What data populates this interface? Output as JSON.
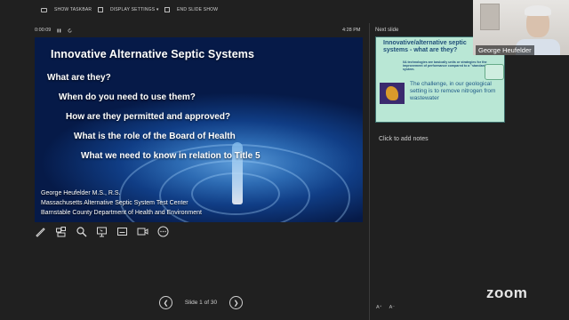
{
  "toolbar": {
    "show_taskbar": "SHOW TASKBAR",
    "display_settings": "DISPLAY SETTINGS ▾",
    "end_slide_show": "END SLIDE SHOW"
  },
  "presenter": {
    "elapsed": "0:00:09",
    "clock": "4:28 PM",
    "next_slide_label": "Next slide",
    "notes_placeholder": "Click to add notes",
    "slide_counter": "Slide 1 of 30",
    "prev_icon": "chevron-left-icon",
    "next_icon": "chevron-right-icon"
  },
  "current_slide": {
    "title": "Innovative Alternative Septic Systems",
    "bullets": [
      "What  are they?",
      "When do you need to use them?",
      "How are they permitted and approved?",
      "What is the role of the Board of Health",
      "What we need to know in relation to Title 5"
    ],
    "footer": [
      "George Heufelder M.S., R.S.",
      "Massachusetts Alternative Septic System Test Center",
      "Barnstable County Department of Health and Environment"
    ]
  },
  "next_slide": {
    "title": "Innovative/alternative septic systems  - what are they?",
    "text": "I/A technologies are basically units or strategies for the improvement of performance compared to a \"standard\" septic system.",
    "challenge": "The challenge, in our geological setting is to remove nitrogen from wastewater"
  },
  "tools": [
    "pen-icon",
    "see-all-slides-icon",
    "zoom-icon",
    "pointer-icon",
    "subtitles-icon",
    "camera-icon",
    "more-options-icon"
  ],
  "font_controls": {
    "increase": "A⁺",
    "decrease": "A⁻"
  },
  "webcam": {
    "name": "George Heufelder"
  },
  "brand": {
    "logo_text": "zoom"
  },
  "colors": {
    "background": "#202020",
    "slide_blue": "#103d85",
    "next_slide_bg": "#b9e7d5",
    "next_slide_text": "#1f4e79"
  }
}
